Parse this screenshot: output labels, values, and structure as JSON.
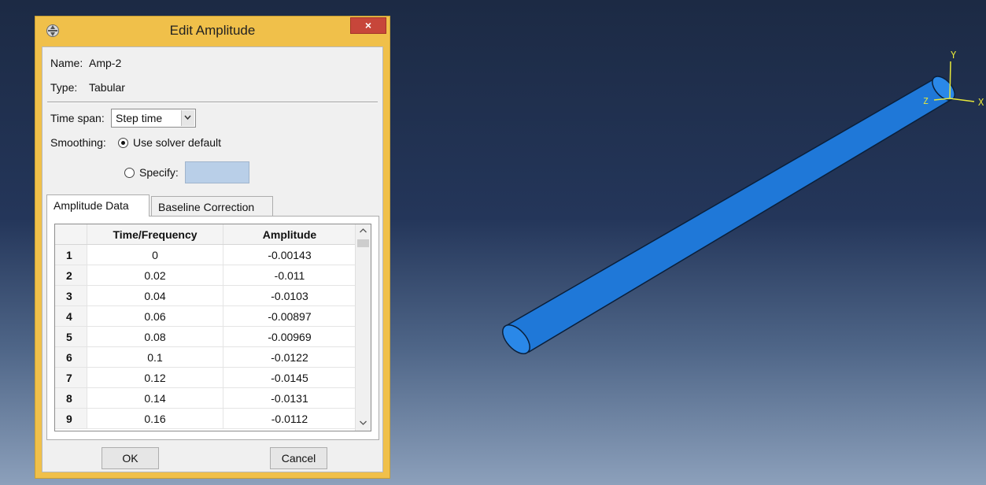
{
  "dialog": {
    "title": "Edit Amplitude",
    "close_label": "×",
    "name_label": "Name:",
    "name_value": "Amp-2",
    "type_label": "Type:",
    "type_value": "Tabular",
    "time_span_label": "Time span:",
    "time_span_value": "Step time",
    "smoothing_label": "Smoothing:",
    "smoothing_options": [
      {
        "label": "Use solver default",
        "selected": true
      },
      {
        "label": "Specify:",
        "selected": false
      }
    ],
    "specify_value": "",
    "tabs": [
      {
        "label": "Amplitude Data",
        "active": true
      },
      {
        "label": "Baseline Correction",
        "active": false
      }
    ],
    "table": {
      "columns": [
        "Time/Frequency",
        "Amplitude"
      ],
      "rows": [
        {
          "index": "1",
          "time": "0",
          "amp": "-0.00143"
        },
        {
          "index": "2",
          "time": "0.02",
          "amp": "-0.011"
        },
        {
          "index": "3",
          "time": "0.04",
          "amp": "-0.0103"
        },
        {
          "index": "4",
          "time": "0.06",
          "amp": "-0.00897"
        },
        {
          "index": "5",
          "time": "0.08",
          "amp": "-0.00969"
        },
        {
          "index": "6",
          "time": "0.1",
          "amp": "-0.0122"
        },
        {
          "index": "7",
          "time": "0.12",
          "amp": "-0.0145"
        },
        {
          "index": "8",
          "time": "0.14",
          "amp": "-0.0131"
        },
        {
          "index": "9",
          "time": "0.16",
          "amp": "-0.0112"
        }
      ]
    },
    "ok_label": "OK",
    "cancel_label": "Cancel"
  },
  "viewport": {
    "triad": {
      "x": "X",
      "y": "Y",
      "z": "Z"
    },
    "colors": {
      "pipe": "#1f78d8",
      "triad": "#e8e83a",
      "background_top": "#1c2a44",
      "background_bottom": "#8ca0bb"
    }
  }
}
